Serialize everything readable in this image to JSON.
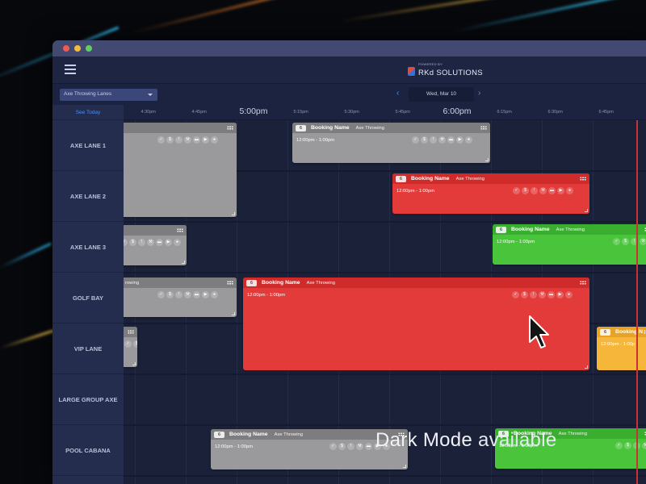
{
  "brand": {
    "tagline": "POWERED BY",
    "name": "RKd SOLUTIONS"
  },
  "toolbar": {
    "lane_select": "Axe Throwing Lanes",
    "date": "Wed, Mar 10",
    "prev": "‹",
    "next": "›"
  },
  "lanes_header": {
    "see_today": "See Today"
  },
  "lanes": [
    "AXE LANE 1",
    "AXE LANE 2",
    "AXE LANE 3",
    "GOLF BAY",
    "VIP LANE",
    "LARGE GROUP AXE",
    "POOL CABANA"
  ],
  "times": [
    {
      "label": "4:30pm",
      "major": false
    },
    {
      "label": "4:45pm",
      "major": false
    },
    {
      "label": "5:00pm",
      "major": true
    },
    {
      "label": "5:15pm",
      "major": false
    },
    {
      "label": "5:30pm",
      "major": false
    },
    {
      "label": "5:45pm",
      "major": false
    },
    {
      "label": "6:00pm",
      "major": true
    },
    {
      "label": "6:15pm",
      "major": false
    },
    {
      "label": "6:30pm",
      "major": false
    },
    {
      "label": "6:45pm",
      "major": false
    }
  ],
  "bookings": [
    {
      "id": "b1",
      "color": "grey",
      "count": "",
      "name": "",
      "type": "",
      "time": ""
    },
    {
      "id": "b2",
      "color": "grey",
      "count": "6",
      "name": "Booking Name",
      "type": "Axe Throwing",
      "time": "12:00pm - 1:00pm"
    },
    {
      "id": "b3",
      "color": "red",
      "count": "6",
      "name": "Booking Name",
      "type": "Axe Throwing",
      "time": "12:00pm - 1:00pm"
    },
    {
      "id": "b4",
      "color": "grey",
      "count": "",
      "name": "",
      "type": "",
      "time": ""
    },
    {
      "id": "b5",
      "color": "green",
      "count": "6",
      "name": "Booking Name",
      "type": "Axe Throwing",
      "time": "12:00pm - 1:00pm"
    },
    {
      "id": "b6",
      "color": "grey",
      "count": "",
      "name": "",
      "type": "rowing",
      "time": ""
    },
    {
      "id": "b7",
      "color": "red",
      "count": "6",
      "name": "Booking Name",
      "type": "Axe Throwing",
      "time": "12:00pm - 1:00pm"
    },
    {
      "id": "b8",
      "color": "grey",
      "count": "",
      "name": "",
      "type": "",
      "time": ""
    },
    {
      "id": "b9",
      "color": "yellow",
      "count": "6",
      "name": "Booking N",
      "type": "",
      "time": "12:00pm - 1:00p"
    },
    {
      "id": "b10",
      "color": "grey",
      "count": "6",
      "name": "Booking Name",
      "type": "Axe Throwing",
      "time": "12:00pm - 1:00pm"
    },
    {
      "id": "b11",
      "color": "green",
      "count": "6",
      "name": "Booking Name",
      "type": "Axe Throwing",
      "time": "12:00pm - 1:00pm"
    }
  ],
  "action_icons": [
    "check-icon",
    "dollar-icon",
    "info-icon",
    "hammer-icon",
    "card-icon",
    "play-icon",
    "people-icon"
  ],
  "banner": {
    "bold": "Dark Mode",
    "light": "available"
  },
  "colors": {
    "grey": "#9a9a9c",
    "red": "#e33a3a",
    "green": "#49c43b",
    "yellow": "#f5b63a",
    "now_line": "#c93232",
    "accent": "#4d8cf0"
  }
}
